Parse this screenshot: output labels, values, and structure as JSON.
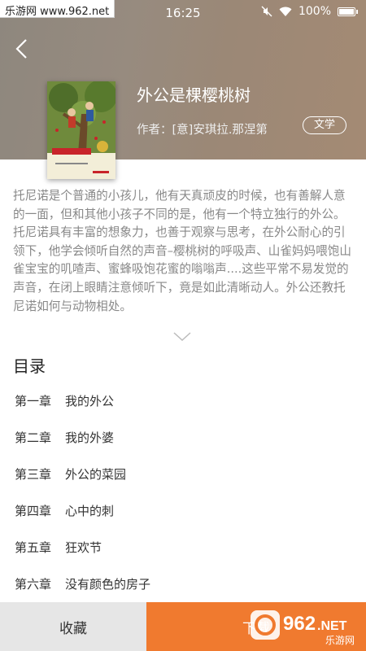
{
  "watermark": {
    "site": "乐游网 www.962.net",
    "brand": "962",
    "suffix": ".NET",
    "sub": "乐游网"
  },
  "status_bar": {
    "time": "16:25",
    "battery": "100%"
  },
  "book": {
    "title": "外公是棵樱桃树",
    "author": "作者：[意]安琪拉.那涅第",
    "genre": "文学"
  },
  "description": [
    "托尼诺是个普通的小孩儿，他有天真顽皮的时候，也有善解人意的一面，但和其他小孩子不同的是，他有一个特立独行的外公。",
    "托尼诺具有丰富的想象力，也善于观察与思考，在外公耐心的引领下，他学会倾听自然的声音–樱桃树的呼吸声、山雀妈妈喂饱山雀宝宝的叽喳声、蜜蜂吸饱花蜜的嗡嗡声....这些平常不易发觉的声音，在闭上眼睛注意倾听下，竟是如此清晰动人。外公还教托尼诺如何与动物相处。"
  ],
  "toc": {
    "title": "目录",
    "chapters": [
      {
        "num": "第一章",
        "name": "我的外公"
      },
      {
        "num": "第二章",
        "name": "我的外婆"
      },
      {
        "num": "第三章",
        "name": "外公的菜园"
      },
      {
        "num": "第四章",
        "name": "心中的刺"
      },
      {
        "num": "第五章",
        "name": "狂欢节"
      },
      {
        "num": "第六章",
        "name": "没有颜色的房子"
      }
    ]
  },
  "actions": {
    "collect": "收藏",
    "read": "下载"
  },
  "colors": {
    "accent": "#f07a2f",
    "header": "#978b7f"
  }
}
